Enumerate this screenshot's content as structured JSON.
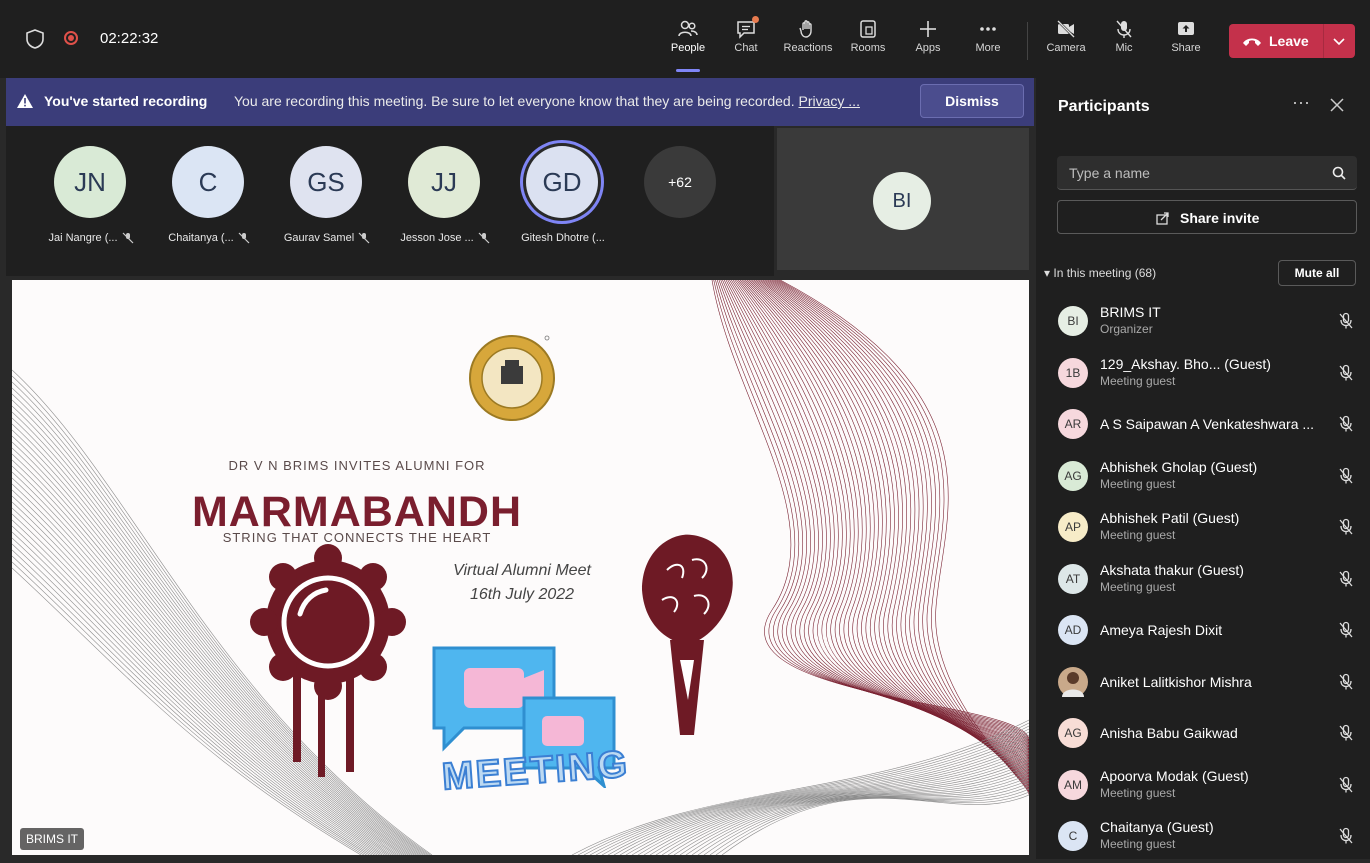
{
  "topbar": {
    "timer": "02:22:32",
    "buttons": [
      {
        "label": "People",
        "icon": "people-icon"
      },
      {
        "label": "Chat",
        "icon": "chat-icon"
      },
      {
        "label": "Reactions",
        "icon": "reactions-icon"
      },
      {
        "label": "Rooms",
        "icon": "rooms-icon"
      },
      {
        "label": "Apps",
        "icon": "plus-icon"
      },
      {
        "label": "More",
        "icon": "more-icon"
      },
      {
        "label": "Camera",
        "icon": "camera-off-icon"
      },
      {
        "label": "Mic",
        "icon": "mic-off-icon"
      },
      {
        "label": "Share",
        "icon": "share-icon"
      }
    ],
    "leave_label": "Leave"
  },
  "banner": {
    "title": "You've started recording",
    "message": "You are recording this meeting. Be sure to let everyone know that they are being recorded.",
    "privacy": "Privacy ...",
    "dismiss": "Dismiss"
  },
  "strip": {
    "tiles": [
      {
        "initials": "JN",
        "name": "Jai Nangre (..."
      },
      {
        "initials": "C",
        "name": "Chaitanya (..."
      },
      {
        "initials": "GS",
        "name": "Gaurav Samel"
      },
      {
        "initials": "JJ",
        "name": "Jesson Jose ..."
      },
      {
        "initials": "GD",
        "name": "Gitesh Dhotre (..."
      }
    ],
    "more": "+62",
    "presenter_initials": "BI"
  },
  "stage": {
    "invite": "DR V N BRIMS INVITES ALUMNI FOR",
    "title": "MARMABANDH",
    "subtitle": "STRING THAT CONNECTS THE HEART",
    "event": "Virtual Alumni Meet",
    "date": "16th July 2022",
    "meeting_word": "MEETING",
    "name_tag": "BRIMS IT"
  },
  "panel": {
    "title": "Participants",
    "search_placeholder": "Type a name",
    "share_invite": "Share invite",
    "in_meeting": "In this meeting (68)",
    "mute_all": "Mute all",
    "participants": [
      {
        "initials": "BI",
        "name": "BRIMS IT",
        "role": "Organizer",
        "color": "#e6eee4"
      },
      {
        "initials": "1B",
        "name": "129_Akshay. Bho... (Guest)",
        "role": "Meeting guest",
        "color": "#f6d8dd"
      },
      {
        "initials": "AR",
        "name": "A S Saipawan A Venkateshwara ...",
        "role": "",
        "color": "#f6d8dd"
      },
      {
        "initials": "AG",
        "name": "Abhishek Gholap (Guest)",
        "role": "Meeting guest",
        "color": "#d9ead6"
      },
      {
        "initials": "AP",
        "name": "Abhishek Patil (Guest)",
        "role": "Meeting guest",
        "color": "#f7ecc8"
      },
      {
        "initials": "AT",
        "name": "Akshata thakur (Guest)",
        "role": "Meeting guest",
        "color": "#dde7e8"
      },
      {
        "initials": "AD",
        "name": "Ameya Rajesh Dixit",
        "role": "",
        "color": "#dbe5f4"
      },
      {
        "initials": "",
        "name": "Aniket Lalitkishor Mishra",
        "role": "",
        "color": "#c9a98a"
      },
      {
        "initials": "AG",
        "name": "Anisha Babu Gaikwad",
        "role": "",
        "color": "#f8ddd6"
      },
      {
        "initials": "AM",
        "name": "Apoorva Modak (Guest)",
        "role": "Meeting guest",
        "color": "#f6d8dd"
      },
      {
        "initials": "C",
        "name": "Chaitanya (Guest)",
        "role": "Meeting guest",
        "color": "#dbe5f4"
      }
    ]
  }
}
